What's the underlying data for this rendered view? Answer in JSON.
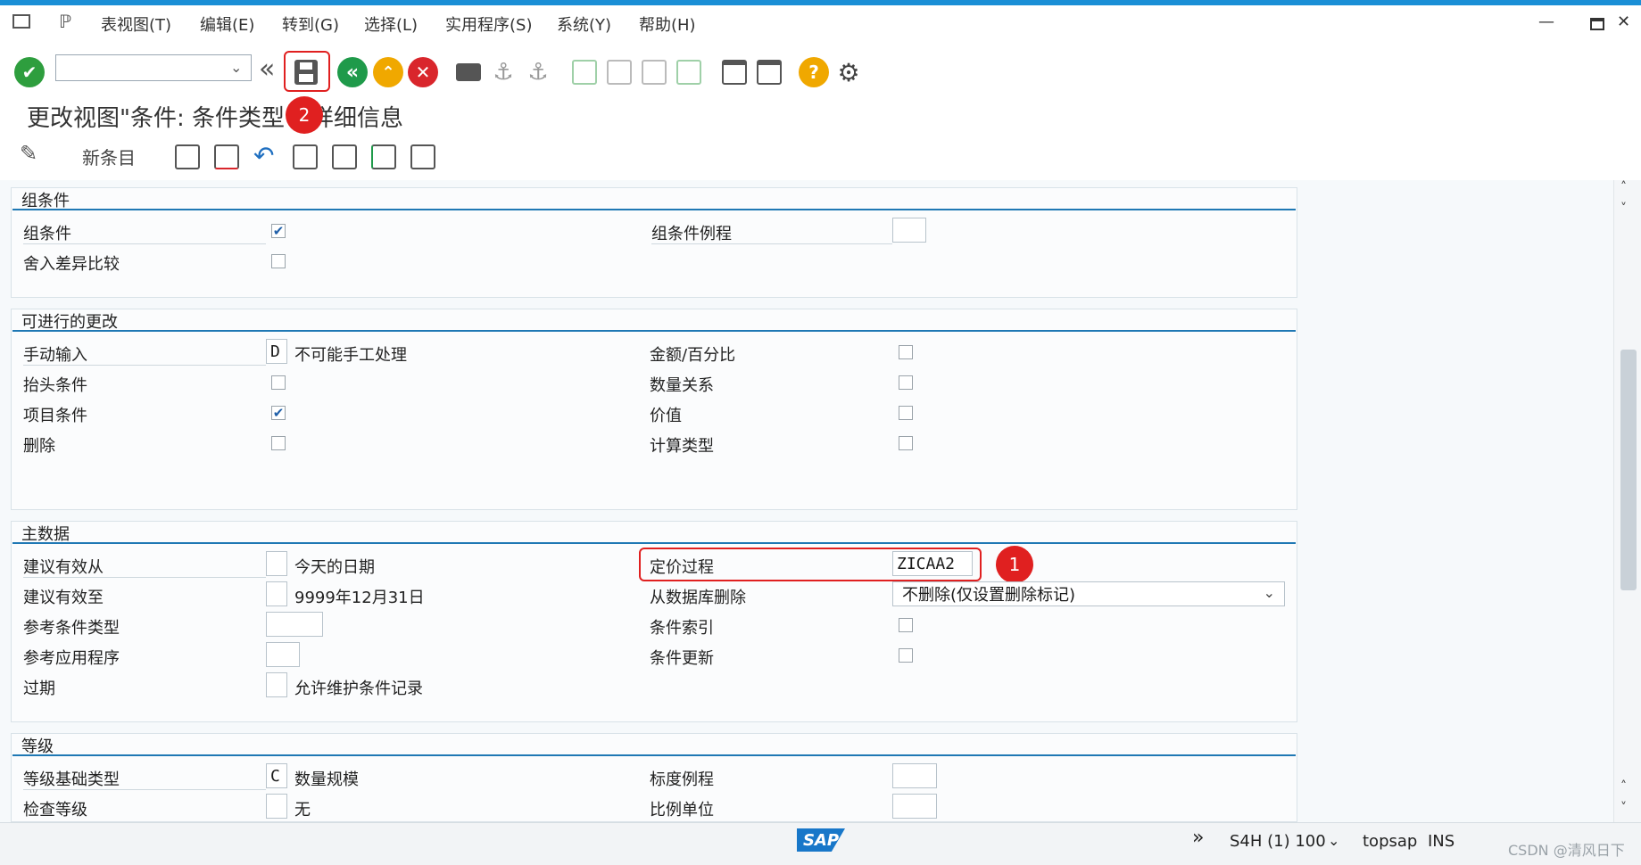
{
  "menu": {
    "items": [
      "表视图(T)",
      "编辑(E)",
      "转到(G)",
      "选择(L)",
      "实用程序(S)",
      "系统(Y)",
      "帮助(H)"
    ]
  },
  "toolbar": {
    "icons": [
      "enter-icon",
      "save-icon",
      "back-icon",
      "exit-icon",
      "cancel-icon",
      "print-icon",
      "find-icon",
      "find-next-icon",
      "first-page-icon",
      "previous-page-icon",
      "next-page-icon",
      "last-page-icon",
      "new-session-icon",
      "shortcut-icon",
      "help-icon",
      "settings-icon"
    ]
  },
  "page": {
    "title": "更改视图\"条件: 条件类型\": 详细信息"
  },
  "app_toolbar": {
    "new_entries": "新条目"
  },
  "groups": {
    "group_conditions": {
      "header": "组条件",
      "rows": [
        {
          "label": "组条件",
          "checked": true
        },
        {
          "label": "舍入差异比较",
          "checked": false
        }
      ],
      "routine_label": "组条件例程",
      "routine_value": ""
    },
    "possible_changes": {
      "header": "可进行的更改",
      "manual_entry_label": "手动输入",
      "manual_entry_value": "D",
      "manual_entry_desc": "不可能手工处理",
      "header_cond_label": "抬头条件",
      "header_cond_checked": false,
      "item_cond_label": "项目条件",
      "item_cond_checked": true,
      "delete_label": "删除",
      "delete_checked": false,
      "amount_pct_label": "金额/百分比",
      "amount_pct_checked": false,
      "qty_rel_label": "数量关系",
      "qty_rel_checked": false,
      "value_label": "价值",
      "value_checked": false,
      "calc_type_label": "计算类型",
      "calc_type_checked": false
    },
    "master_data": {
      "header": "主数据",
      "valid_from_label": "建议有效从",
      "valid_from_desc": "今天的日期",
      "valid_to_label": "建议有效至",
      "valid_to_desc": "9999年12月31日",
      "ref_cond_type_label": "参考条件类型",
      "ref_app_label": "参考应用程序",
      "expire_label": "过期",
      "expire_desc": "允许维护条件记录",
      "pricing_proc_label": "定价过程",
      "pricing_proc_value": "ZICAA2",
      "delete_db_label": "从数据库删除",
      "delete_db_value": "不删除(仅设置删除标记)",
      "cond_index_label": "条件索引",
      "cond_index_checked": false,
      "cond_update_label": "条件更新",
      "cond_update_checked": false
    },
    "scales": {
      "header": "等级",
      "scale_base_label": "等级基础类型",
      "scale_base_value": "C",
      "scale_base_desc": "数量规模",
      "check_scale_label": "检查等级",
      "check_scale_desc": "无",
      "scale_routine_label": "标度例程",
      "scale_unit_label": "比例单位"
    }
  },
  "annotations": {
    "badge1": "1",
    "badge2": "2"
  },
  "status": {
    "logo": "SAP",
    "system": "S4H (1) 100",
    "server": "topsap",
    "mode": "INS",
    "watermark": "CSDN @清风日下"
  },
  "colors": {
    "accent": "#1a8fd6",
    "section_line": "#1f78b4",
    "highlight": "#e02020",
    "enter_green": "#2e9e3e",
    "back_green": "#1f9a4a",
    "exit_yellow": "#f0a800",
    "cancel_red": "#d9262c"
  }
}
